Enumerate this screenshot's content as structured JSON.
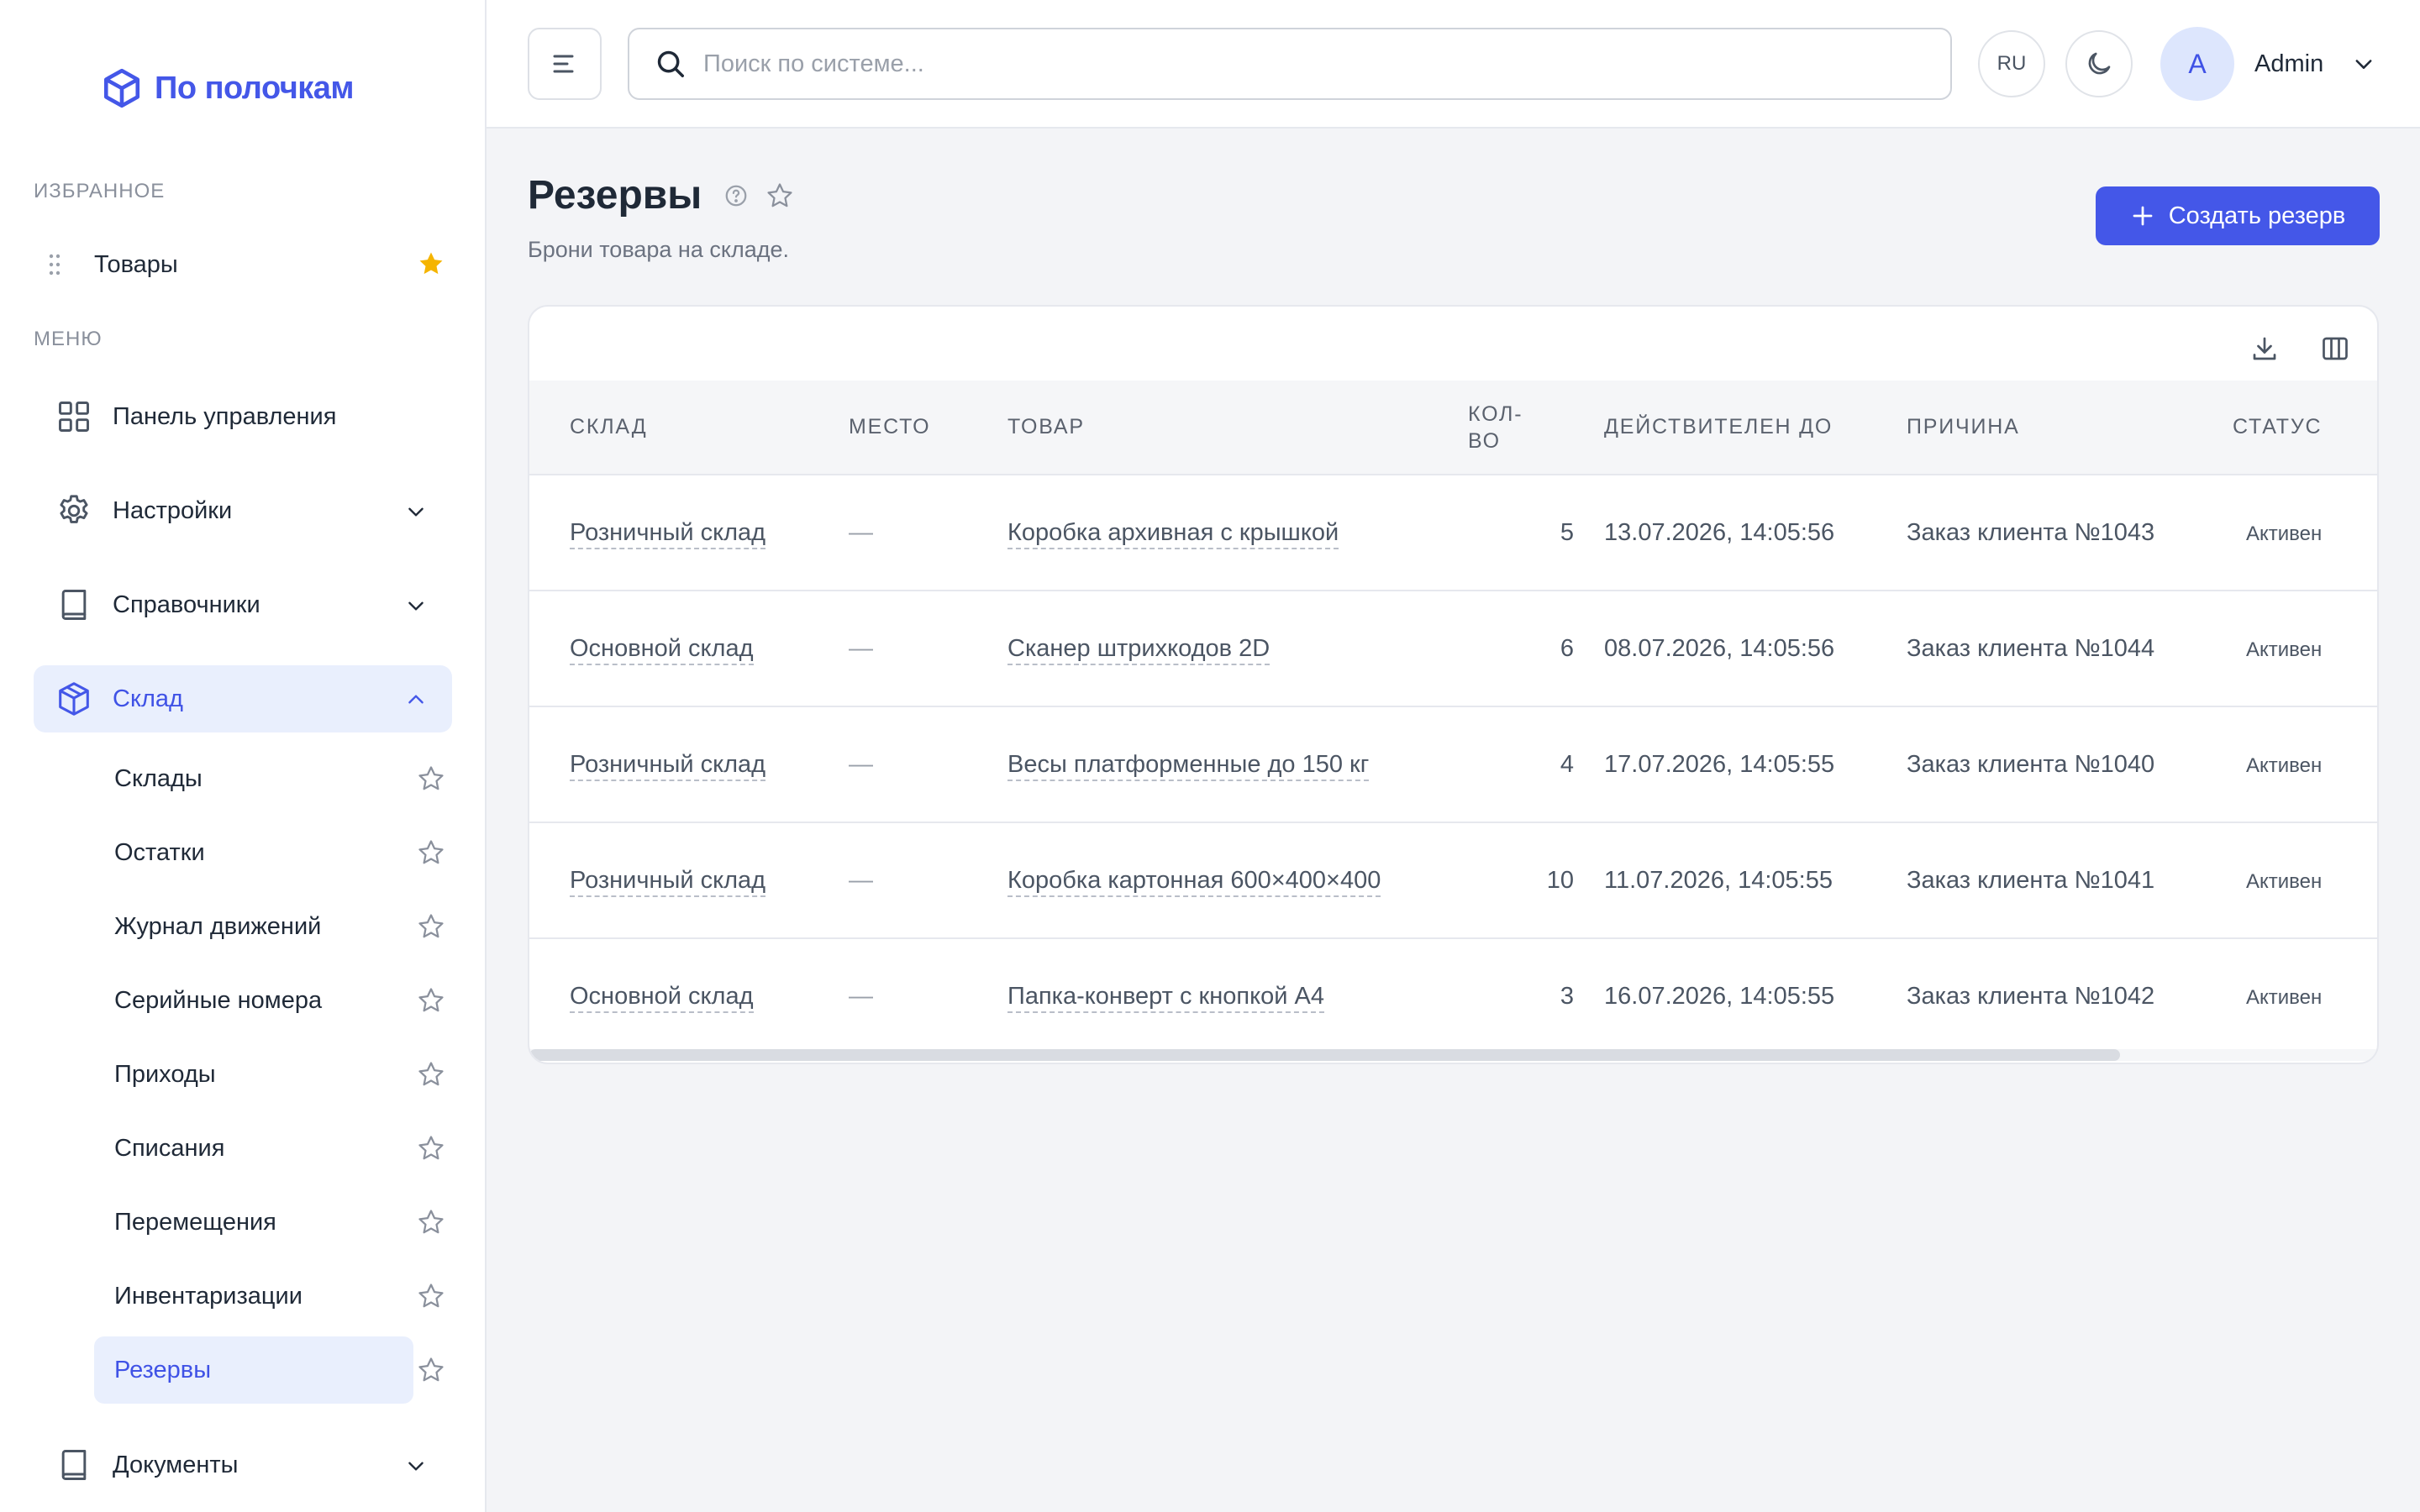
{
  "app": {
    "logo_text": "По полочкам"
  },
  "sidebar": {
    "favorites_label": "ИЗБРАННОЕ",
    "favorites": [
      {
        "label": "Товары"
      }
    ],
    "menu_label": "МЕНЮ",
    "items": [
      {
        "label": "Панель управления",
        "icon": "dashboard-grid-icon"
      },
      {
        "label": "Настройки",
        "icon": "gear-icon"
      },
      {
        "label": "Справочники",
        "icon": "book-icon"
      },
      {
        "label": "Склад",
        "icon": "box-icon",
        "expanded": true,
        "active": true
      },
      {
        "label": "Документы",
        "icon": "book-icon"
      }
    ],
    "warehouse_subitems": [
      {
        "label": "Склады"
      },
      {
        "label": "Остатки"
      },
      {
        "label": "Журнал движений"
      },
      {
        "label": "Серийные номера"
      },
      {
        "label": "Приходы"
      },
      {
        "label": "Списания"
      },
      {
        "label": "Перемещения"
      },
      {
        "label": "Инвентаризации"
      },
      {
        "label": "Резервы",
        "active": true
      }
    ]
  },
  "topbar": {
    "search_placeholder": "Поиск по системе...",
    "lang": "RU",
    "user_initial": "A",
    "user_name": "Admin"
  },
  "page": {
    "title": "Резервы",
    "subtitle": "Брони товара на складе.",
    "create_button": "Создать резерв"
  },
  "table": {
    "columns": [
      "СКЛАД",
      "МЕСТО",
      "ТОВАР",
      "КОЛ-\nВО",
      "ДЕЙСТВИТЕЛЕН ДО",
      "ПРИЧИНА",
      "СТАТУС"
    ],
    "rows": [
      {
        "warehouse": "Розничный склад",
        "place": "—",
        "product": "Коробка архивная с крышкой",
        "qty": "5",
        "valid_until": "13.07.2026, 14:05:56",
        "reason": "Заказ клиента №1043",
        "status": "Активен"
      },
      {
        "warehouse": "Основной склад",
        "place": "—",
        "product": "Сканер штрихкодов 2D",
        "qty": "6",
        "valid_until": "08.07.2026, 14:05:56",
        "reason": "Заказ клиента №1044",
        "status": "Активен"
      },
      {
        "warehouse": "Розничный склад",
        "place": "—",
        "product": "Весы платформенные до 150 кг",
        "qty": "4",
        "valid_until": "17.07.2026, 14:05:55",
        "reason": "Заказ клиента №1040",
        "status": "Активен"
      },
      {
        "warehouse": "Розничный склад",
        "place": "—",
        "product": "Коробка картонная 600×400×400",
        "qty": "10",
        "valid_until": "11.07.2026, 14:05:55",
        "reason": "Заказ клиента №1041",
        "status": "Активен"
      },
      {
        "warehouse": "Основной склад",
        "place": "—",
        "product": "Папка-конверт с кнопкой А4",
        "qty": "3",
        "valid_until": "16.07.2026, 14:05:55",
        "reason": "Заказ клиента №1042",
        "status": "Активен"
      }
    ]
  },
  "colors": {
    "accent": "#4457e8",
    "active_bg": "#e9effd",
    "favorite_star": "#f5b400",
    "page_bg": "#f3f4f7"
  }
}
